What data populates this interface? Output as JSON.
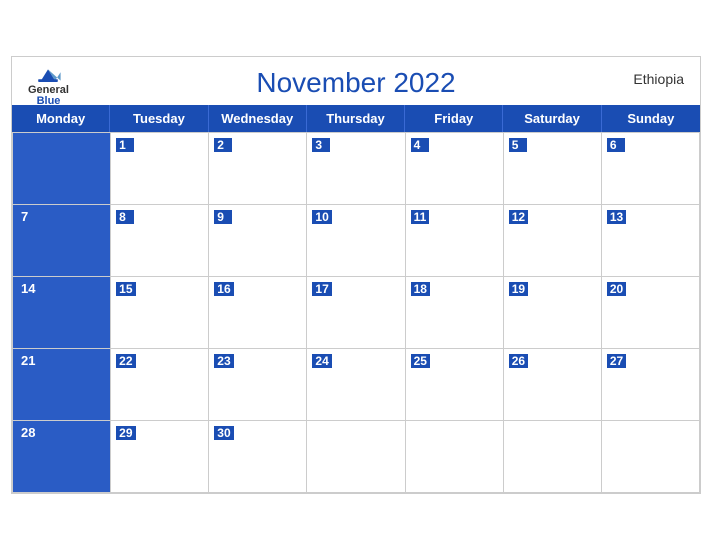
{
  "header": {
    "month_year": "November 2022",
    "country": "Ethiopia",
    "logo_general": "General",
    "logo_blue": "Blue"
  },
  "days_of_week": [
    "Monday",
    "Tuesday",
    "Wednesday",
    "Thursday",
    "Friday",
    "Saturday",
    "Sunday"
  ],
  "weeks": [
    [
      {
        "num": "",
        "empty": true
      },
      {
        "num": "1"
      },
      {
        "num": "2"
      },
      {
        "num": "3"
      },
      {
        "num": "4"
      },
      {
        "num": "5"
      },
      {
        "num": "6"
      }
    ],
    [
      {
        "num": "7"
      },
      {
        "num": "8"
      },
      {
        "num": "9"
      },
      {
        "num": "10"
      },
      {
        "num": "11"
      },
      {
        "num": "12"
      },
      {
        "num": "13"
      }
    ],
    [
      {
        "num": "14"
      },
      {
        "num": "15"
      },
      {
        "num": "16"
      },
      {
        "num": "17"
      },
      {
        "num": "18"
      },
      {
        "num": "19"
      },
      {
        "num": "20"
      }
    ],
    [
      {
        "num": "21"
      },
      {
        "num": "22"
      },
      {
        "num": "23"
      },
      {
        "num": "24"
      },
      {
        "num": "25"
      },
      {
        "num": "26"
      },
      {
        "num": "27"
      }
    ],
    [
      {
        "num": "28"
      },
      {
        "num": "29"
      },
      {
        "num": "30"
      },
      {
        "num": "",
        "empty": true
      },
      {
        "num": "",
        "empty": true
      },
      {
        "num": "",
        "empty": true
      },
      {
        "num": "",
        "empty": true
      }
    ]
  ],
  "colors": {
    "header_blue": "#1a4db3",
    "row_stripe": "#2a5cc5",
    "border": "#ccc",
    "text_white": "#ffffff"
  }
}
